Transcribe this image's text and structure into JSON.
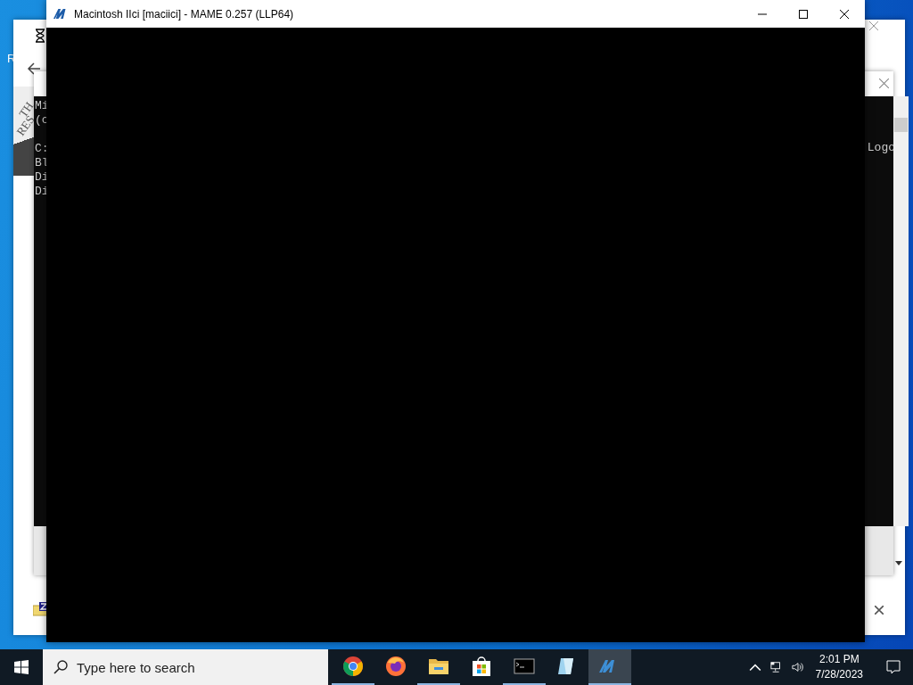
{
  "desktop": {
    "icon_labels": [
      "R"
    ]
  },
  "back_window": {
    "banner_fragments": [
      "TH",
      "RES"
    ]
  },
  "console_window": {
    "left_fragments": [
      "Mi",
      "(c",
      "C:",
      "Bl",
      "Di",
      "Di"
    ],
    "right_fragment": "Logo"
  },
  "window": {
    "title": "Macintosh IIci [maciici] - MAME 0.257 (LLP64)"
  },
  "taskbar": {
    "search": {
      "placeholder": "Type here to search"
    },
    "apps": [
      {
        "kind": "chrome",
        "running": true,
        "selected": false
      },
      {
        "kind": "firefox",
        "running": false,
        "selected": false
      },
      {
        "kind": "explorer",
        "running": true,
        "selected": false
      },
      {
        "kind": "store",
        "running": false,
        "selected": false
      },
      {
        "kind": "terminal",
        "running": true,
        "selected": false
      },
      {
        "kind": "notepad",
        "running": false,
        "selected": false
      },
      {
        "kind": "mame",
        "running": true,
        "selected": true
      }
    ],
    "time": "2:01 PM",
    "date": "7/28/2023"
  }
}
